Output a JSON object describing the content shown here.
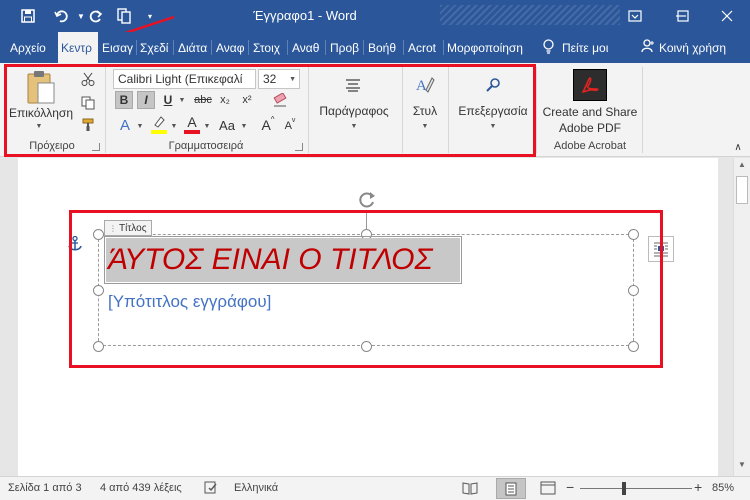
{
  "titlebar": {
    "document_title": "Έγγραφο1  -  Word",
    "icons": [
      "save-icon",
      "undo-icon",
      "redo-icon",
      "touch-mode-icon",
      "customize-icon"
    ],
    "window_controls": [
      "ribbon-display-icon",
      "minimize-icon",
      "maximize-icon",
      "close-icon"
    ]
  },
  "tabs": [
    {
      "label": "Αρχείο"
    },
    {
      "label": "Κεντρ"
    },
    {
      "label": "Εισαγ"
    },
    {
      "label": "Σχεδί"
    },
    {
      "label": "Διάτα"
    },
    {
      "label": "Αναφ"
    },
    {
      "label": "Στοιχ"
    },
    {
      "label": "Αναθ"
    },
    {
      "label": "Προβ"
    },
    {
      "label": "Βοήθ"
    },
    {
      "label": "Acrot"
    },
    {
      "label": "Μορφοποίηση"
    },
    {
      "label": "Πείτε μοι"
    },
    {
      "label": "Κοινή χρήση"
    }
  ],
  "ribbon": {
    "clipboard": {
      "paste_label": "Επικόλληση",
      "group_label": "Πρόχειρο"
    },
    "font": {
      "font_name": "Calibri Light (Επικεφαλί",
      "font_size": "32",
      "bold": "B",
      "italic": "I",
      "underline": "U",
      "strike": "abc",
      "subscript": "x₂",
      "superscript": "x²",
      "font_color": "A",
      "change_case": "Aa",
      "grow": "A",
      "shrink": "A",
      "group_label": "Γραμματοσειρά"
    },
    "paragraph_label": "Παράγραφος",
    "styles_label": "Στυλ",
    "editing_label": "Επεξεργασία",
    "acrobat": {
      "create_line1": "Create and Share",
      "create_line2": "Adobe PDF",
      "group_label": "Adobe Acrobat"
    }
  },
  "document": {
    "content_control_tag": "Τίτλος",
    "title_text": "ΆΥΤΟΣ ΕΙΝΑΙ Ο ΤΙΤΛΟΣ",
    "subtitle_text": "[Υπότιτλος εγγράφου]"
  },
  "status": {
    "page_info": "Σελίδα 1 από 3",
    "word_count": "4 από 439 λέξεις",
    "language": "Ελληνικά",
    "zoom": "85%",
    "zoom_minus": "−",
    "zoom_plus": "+"
  },
  "colors": {
    "word_blue": "#2b579a",
    "highlight_red": "#e81123",
    "title_red": "#c00000",
    "subtitle_blue": "#4472c4",
    "selection_gray": "#c8c8c8"
  }
}
